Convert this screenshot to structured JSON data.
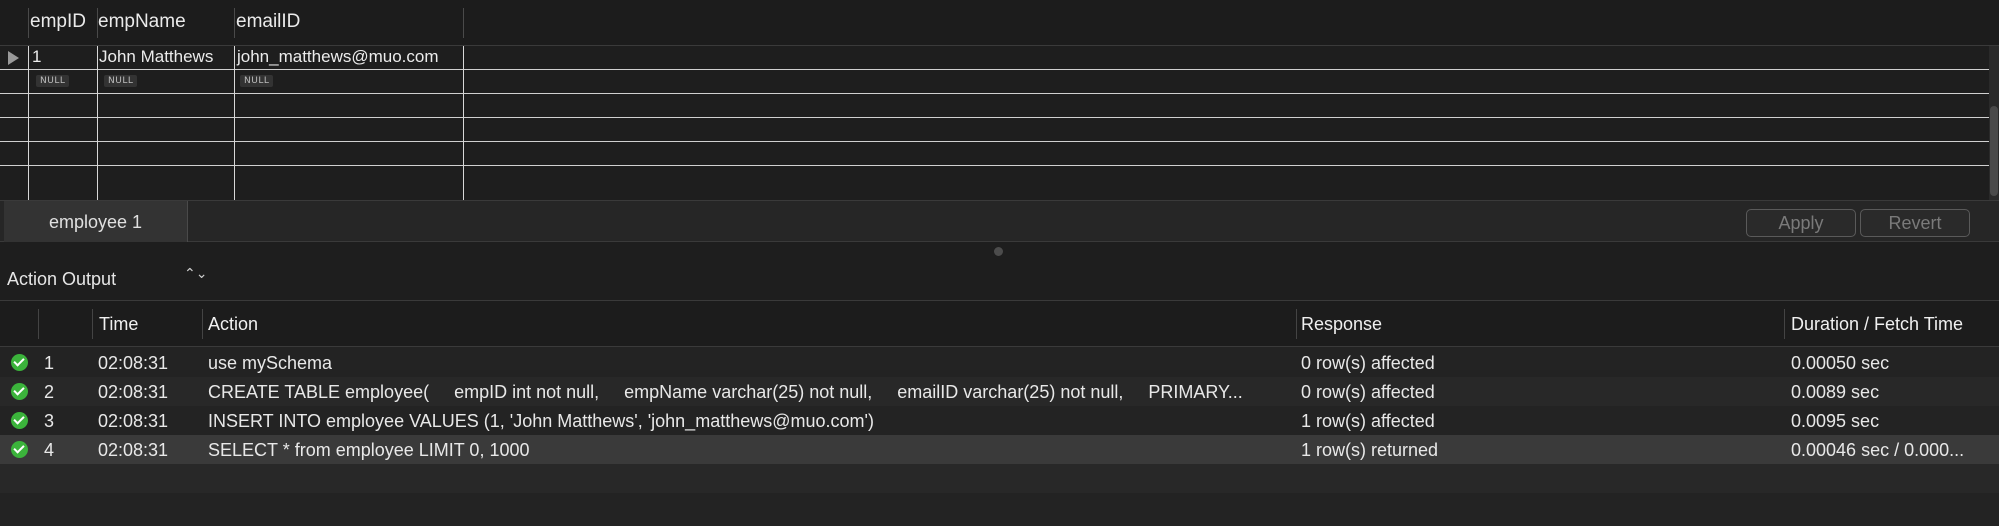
{
  "grid": {
    "columns": [
      "empID",
      "empName",
      "emailID"
    ],
    "rows": [
      {
        "values": [
          "1",
          "John Matthews",
          "john_matthews@muo.com"
        ],
        "current": true
      },
      {
        "values": [
          "NULL",
          "NULL",
          "NULL"
        ],
        "current": false
      }
    ]
  },
  "tabbar": {
    "tab_label": "employee 1",
    "apply_label": "Apply",
    "revert_label": "Revert"
  },
  "action_output": {
    "title": "Action Output",
    "selector_glyph": "⌃⌄",
    "columns": [
      "",
      "",
      "Time",
      "Action",
      "Response",
      "Duration / Fetch Time"
    ],
    "rows": [
      {
        "num": "1",
        "time": "02:08:31",
        "action": "use mySchema",
        "response": "0 row(s) affected",
        "duration": "0.00050 sec"
      },
      {
        "num": "2",
        "time": "02:08:31",
        "action": "CREATE TABLE employee(     empID int not null,     empName varchar(25) not null,     emailID varchar(25) not null,     PRIMARY...",
        "response": "0 row(s) affected",
        "duration": "0.0089 sec"
      },
      {
        "num": "3",
        "time": "02:08:31",
        "action": "INSERT INTO employee  VALUES (1, 'John Matthews', 'john_matthews@muo.com')",
        "response": "1 row(s) affected",
        "duration": "0.0095 sec"
      },
      {
        "num": "4",
        "time": "02:08:31",
        "action": "SELECT * from employee LIMIT 0, 1000",
        "response": "1 row(s) returned",
        "duration": "0.00046 sec / 0.000..."
      }
    ],
    "status_icon": "success-check-icon",
    "status_color": "#3bb33b"
  }
}
